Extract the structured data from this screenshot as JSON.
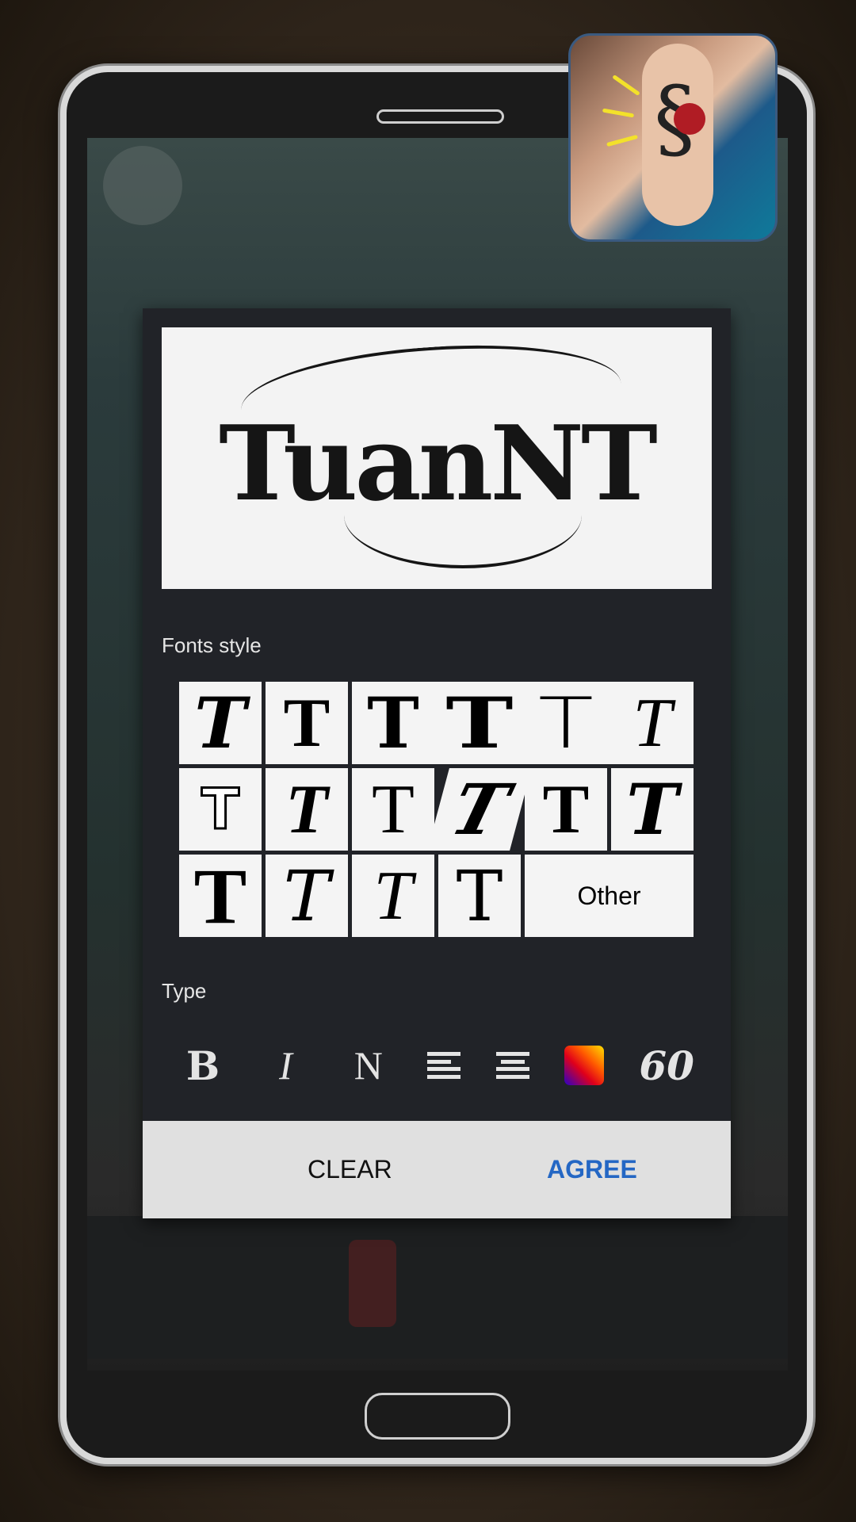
{
  "preview": {
    "text": "TuanNT"
  },
  "fonts_section": {
    "label": "Fonts style",
    "items": [
      {
        "glyph": "T"
      },
      {
        "glyph": "T"
      },
      {
        "glyph": "T"
      },
      {
        "glyph": "T"
      },
      {
        "glyph": "T"
      },
      {
        "glyph": "T"
      },
      {
        "glyph": "T"
      },
      {
        "glyph": "T"
      },
      {
        "glyph": "T"
      },
      {
        "glyph": "T"
      },
      {
        "glyph": "T"
      },
      {
        "glyph": "T"
      },
      {
        "glyph": "T"
      },
      {
        "glyph": "T"
      },
      {
        "glyph": "T"
      },
      {
        "glyph": "T"
      }
    ],
    "other_label": "Other"
  },
  "type_section": {
    "label": "Type",
    "bold": "B",
    "italic": "I",
    "normal": "N",
    "align_left_icon": "align-left-icon",
    "align_center_icon": "align-center-icon",
    "color_icon": "color-gradient-swatch",
    "size": "60"
  },
  "buttons": {
    "clear": "CLEAR",
    "agree": "AGREE"
  },
  "colors": {
    "dialog_bg": "#212328",
    "button_bar_bg": "#e0e0e0",
    "agree": "#2467c4"
  }
}
